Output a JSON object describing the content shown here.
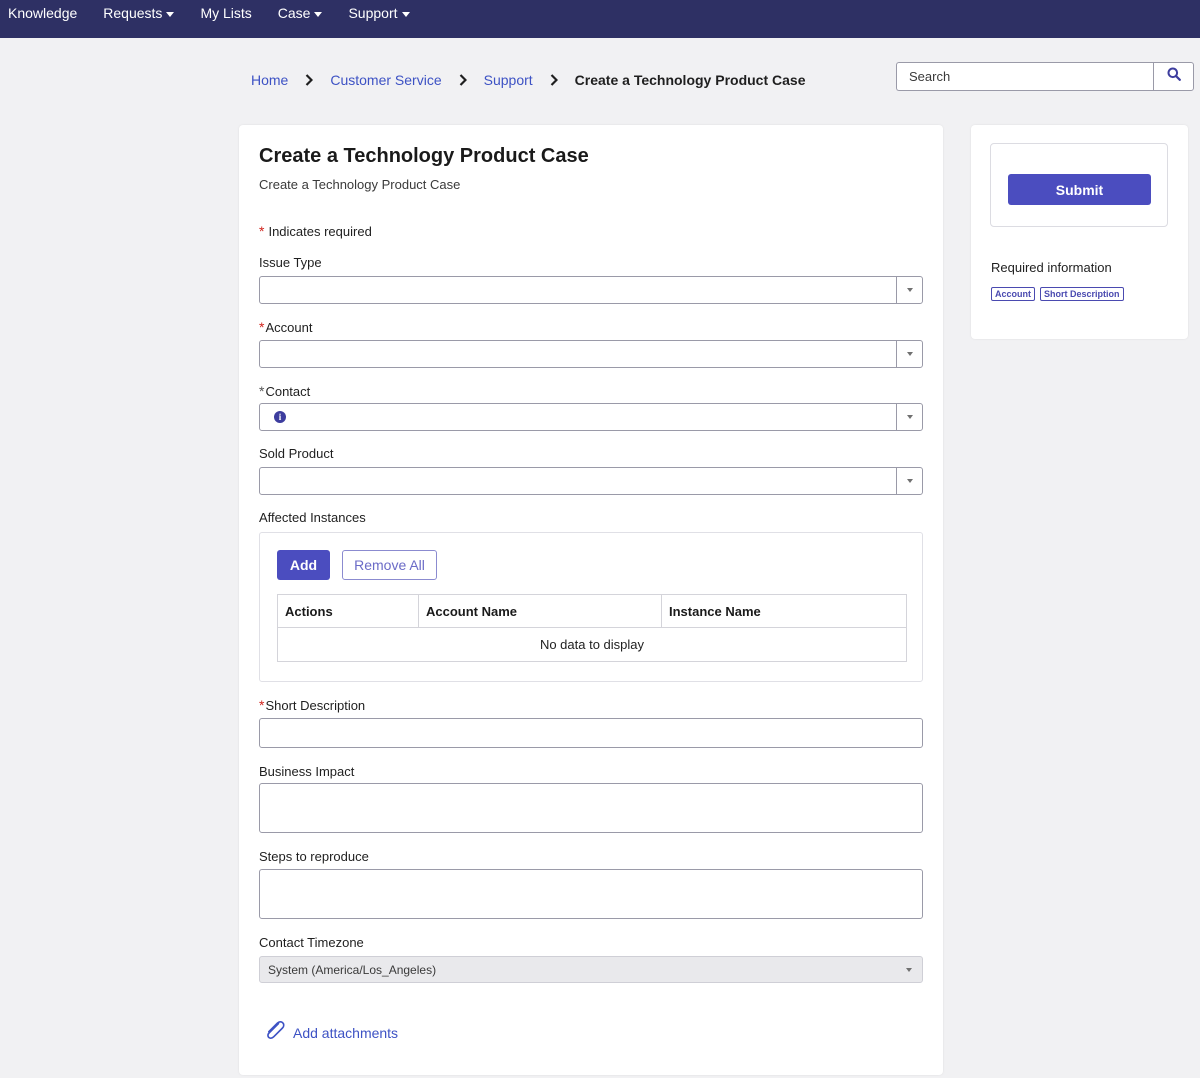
{
  "nav": {
    "items": [
      {
        "label": "Knowledge",
        "dropdown": false
      },
      {
        "label": "Requests",
        "dropdown": true
      },
      {
        "label": "My Lists",
        "dropdown": false
      },
      {
        "label": "Case",
        "dropdown": true
      },
      {
        "label": "Support",
        "dropdown": true
      }
    ]
  },
  "breadcrumb": {
    "items": [
      "Home",
      "Customer Service",
      "Support"
    ],
    "current": "Create a Technology Product Case"
  },
  "search": {
    "placeholder": "Search"
  },
  "form": {
    "title": "Create a Technology Product Case",
    "subtitle": "Create a Technology Product Case",
    "required_star": "*",
    "required_note": "Indicates required",
    "issue_type": {
      "label": "Issue Type",
      "value": ""
    },
    "account": {
      "label": "Account",
      "value": ""
    },
    "contact": {
      "label": "Contact",
      "value": ""
    },
    "sold_product": {
      "label": "Sold Product",
      "value": ""
    },
    "affected_instances": {
      "label": "Affected Instances",
      "add_label": "Add",
      "remove_all_label": "Remove All",
      "columns": [
        "Actions",
        "Account Name",
        "Instance Name"
      ],
      "empty_text": "No data to display"
    },
    "short_description": {
      "label": "Short Description",
      "value": ""
    },
    "business_impact": {
      "label": "Business Impact",
      "value": ""
    },
    "steps_to_reproduce": {
      "label": "Steps to reproduce",
      "value": ""
    },
    "contact_timezone": {
      "label": "Contact Timezone",
      "value": "System (America/Los_Angeles)"
    },
    "attachments_label": "Add attachments"
  },
  "sidebar": {
    "submit_label": "Submit",
    "required_info_title": "Required information",
    "required_tags": [
      "Account",
      "Short Description"
    ]
  },
  "colors": {
    "nav_bg": "#2e3064",
    "primary": "#4b4dbf",
    "link": "#3d52c4",
    "required": "#d0221b"
  }
}
